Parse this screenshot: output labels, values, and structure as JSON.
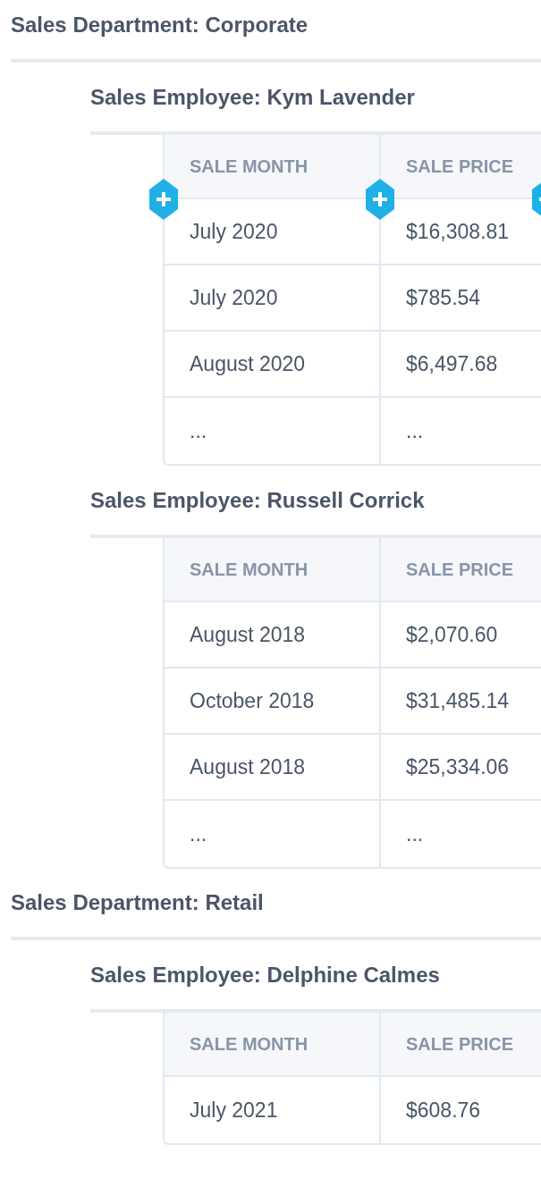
{
  "departments": [
    {
      "title": "Sales Department: Corporate",
      "employees": [
        {
          "title": "Sales Employee: Kym Lavender",
          "show_add_handles": true,
          "columns": [
            "SALE MONTH",
            "SALE PRICE"
          ],
          "rows": [
            [
              "July 2020",
              "$16,308.81"
            ],
            [
              "July 2020",
              "$785.54"
            ],
            [
              "August 2020",
              "$6,497.68"
            ],
            [
              "...",
              "..."
            ]
          ]
        },
        {
          "title": "Sales Employee: Russell Corrick",
          "show_add_handles": false,
          "columns": [
            "SALE MONTH",
            "SALE PRICE"
          ],
          "rows": [
            [
              "August 2018",
              "$2,070.60"
            ],
            [
              "October 2018",
              "$31,485.14"
            ],
            [
              "August 2018",
              "$25,334.06"
            ],
            [
              "...",
              "..."
            ]
          ]
        }
      ]
    },
    {
      "title": "Sales Department: Retail",
      "employees": [
        {
          "title": "Sales Employee: Delphine Calmes",
          "show_add_handles": false,
          "columns": [
            "SALE MONTH",
            "SALE PRICE"
          ],
          "rows": [
            [
              "July 2021",
              "$608.76"
            ]
          ]
        }
      ]
    }
  ]
}
